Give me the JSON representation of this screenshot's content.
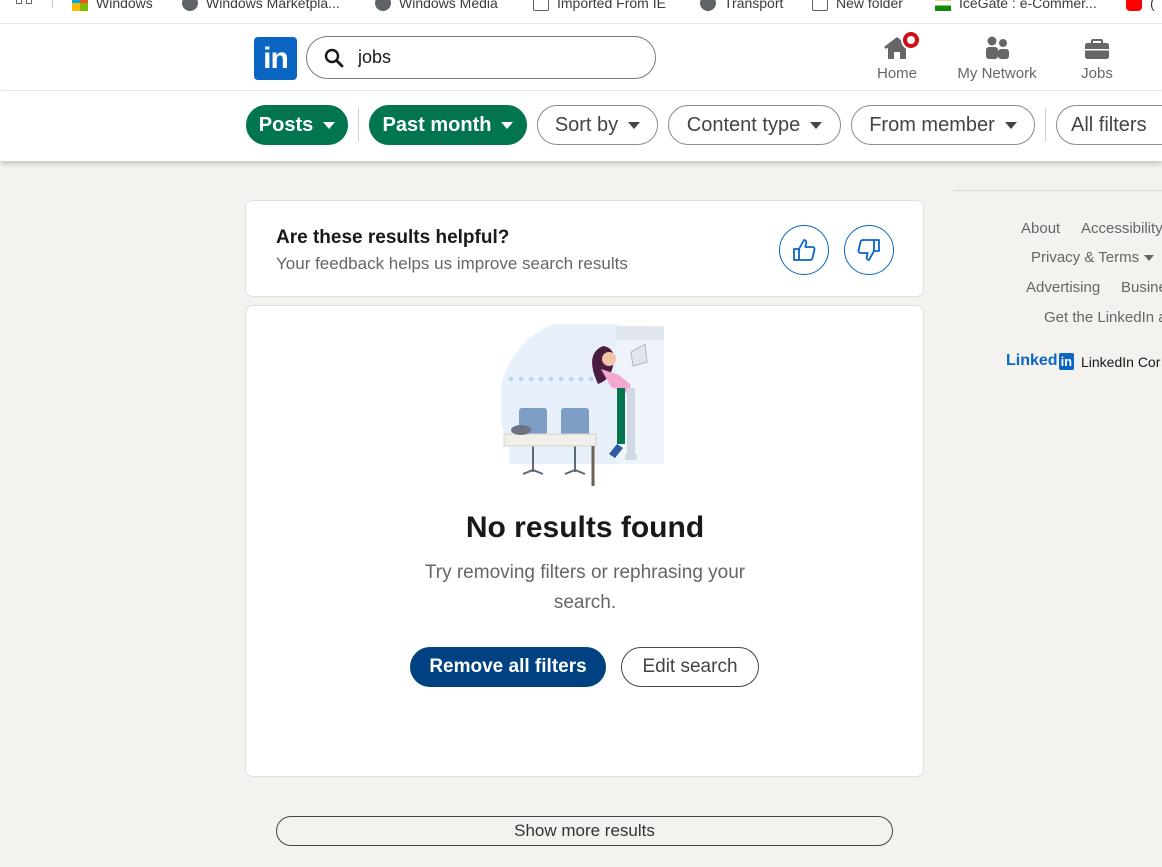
{
  "browser": {
    "bookmarks": [
      {
        "label": "Windows",
        "icon": "windows-icon"
      },
      {
        "label": "Windows Marketpla...",
        "icon": "globe-icon"
      },
      {
        "label": "Windows Media",
        "icon": "globe-icon"
      },
      {
        "label": "Imported From IE",
        "icon": "folder-icon"
      },
      {
        "label": "Transport",
        "icon": "globe-icon"
      },
      {
        "label": "New folder",
        "icon": "folder-icon"
      },
      {
        "label": "IceGate : e-Commer...",
        "icon": "india-flag-icon"
      },
      {
        "label": "(",
        "icon": "youtube-icon"
      }
    ]
  },
  "header": {
    "logo_text": "in",
    "search": {
      "value": "jobs",
      "placeholder": "Search"
    },
    "nav": [
      {
        "label": "Home",
        "icon": "home-icon"
      },
      {
        "label": "My Network",
        "icon": "network-icon"
      },
      {
        "label": "Jobs",
        "icon": "briefcase-icon"
      }
    ]
  },
  "filters": {
    "items": [
      {
        "label": "Posts",
        "active": true
      },
      {
        "label": "Past month",
        "active": true
      },
      {
        "label": "Sort by",
        "active": false
      },
      {
        "label": "Content type",
        "active": false
      },
      {
        "label": "From member",
        "active": false
      }
    ],
    "all_filters": "All filters"
  },
  "feedback": {
    "title": "Are these results helpful?",
    "subtitle": "Your feedback helps us improve search results",
    "thumbs_up_icon": "thumbs-up-icon",
    "thumbs_down_icon": "thumbs-down-icon"
  },
  "empty_state": {
    "title": "No results found",
    "subtitle": "Try removing filters or rephrasing your search.",
    "primary_button": "Remove all filters",
    "secondary_button": "Edit search"
  },
  "show_more": "Show more results",
  "footer": {
    "about": "About",
    "accessibility": "Accessibility",
    "privacy": "Privacy & Terms",
    "advertising": "Advertising",
    "business": "Busine",
    "get_app": "Get the LinkedIn a",
    "brand_linked": "Linked",
    "brand_in": "in",
    "corp": "LinkedIn Cor"
  },
  "colors": {
    "brand_blue": "#0a66c2",
    "filter_green": "#01754f",
    "primary_button": "#004182",
    "notification_red": "#cc1016"
  }
}
